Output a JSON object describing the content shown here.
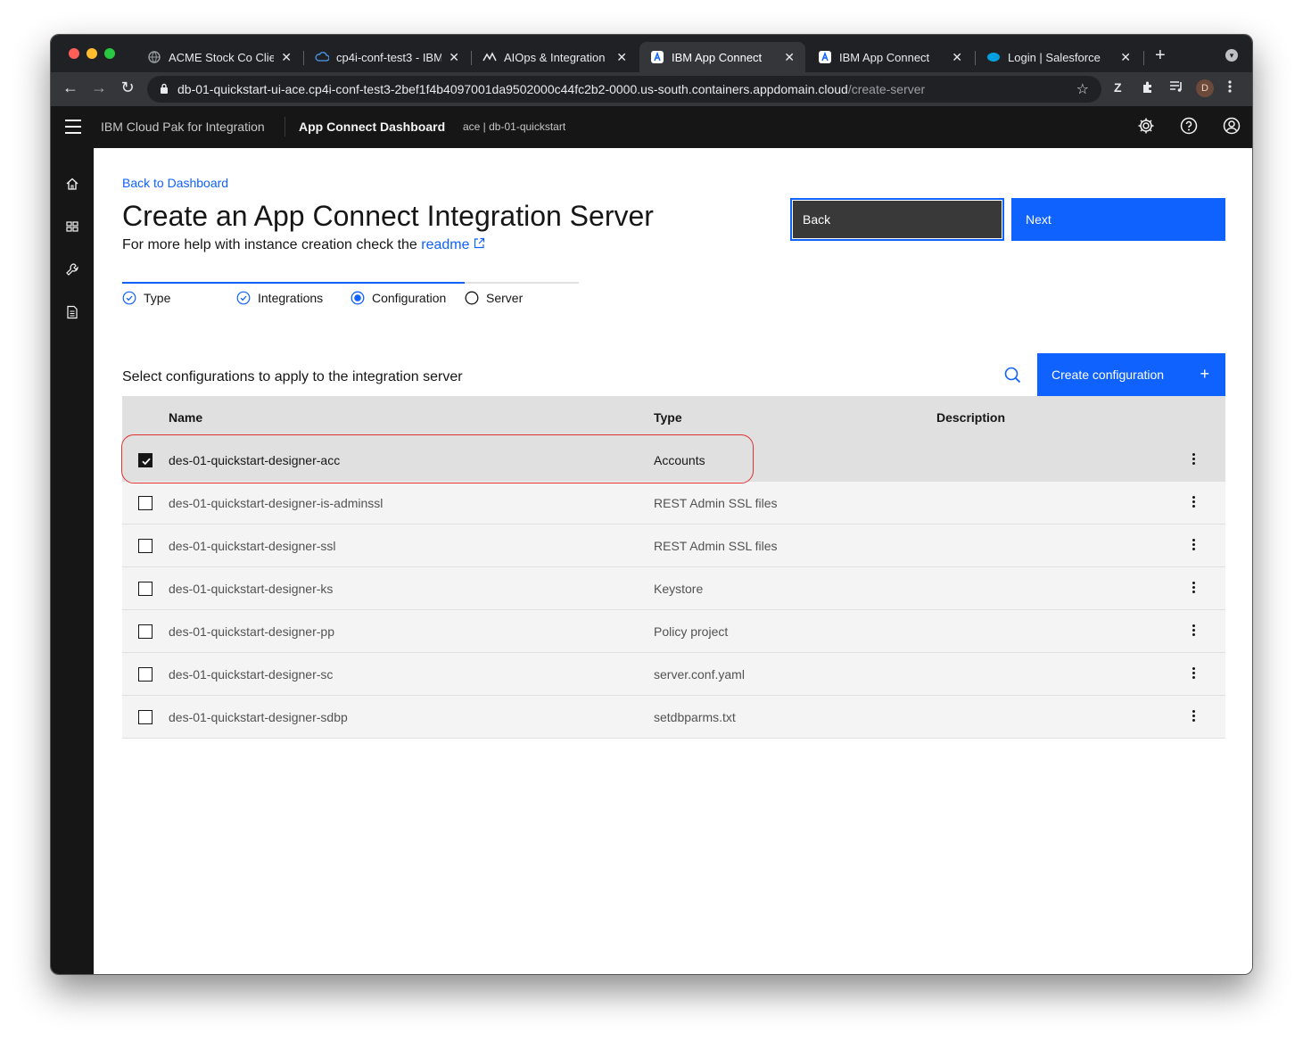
{
  "browser": {
    "tabs": [
      {
        "title": "ACME Stock Co Client",
        "icon": "globe-icon",
        "active": false
      },
      {
        "title": "cp4i-conf-test3 - IBM",
        "icon": "ibm-cloud-icon",
        "active": false
      },
      {
        "title": "AIOps & Integration Ex",
        "icon": "aiops-icon",
        "active": false
      },
      {
        "title": "IBM App Connect",
        "icon": "app-connect-icon",
        "active": true
      },
      {
        "title": "IBM App Connect",
        "icon": "app-connect-icon",
        "active": false
      },
      {
        "title": "Login | Salesforce",
        "icon": "salesforce-icon",
        "active": false
      }
    ],
    "url_host": "db-01-quickstart-ui-ace.cp4i-conf-test3-2bef1f4b4097001da9502000c44fc2b2-0000.us-south.containers.appdomain.cloud",
    "url_path": "/create-server",
    "profile_initial": "D",
    "extension_label": "Z"
  },
  "header": {
    "product": "IBM Cloud Pak for Integration",
    "app_name": "App Connect Dashboard",
    "instance": "ace | db-01-quickstart"
  },
  "page": {
    "back_link": "Back to Dashboard",
    "title": "Create an App Connect Integration Server",
    "help_prefix": "For more help with instance creation check the ",
    "help_link": "readme",
    "back_button": "Back",
    "next_button": "Next"
  },
  "progress": {
    "steps": [
      {
        "label": "Type",
        "state": "complete"
      },
      {
        "label": "Integrations",
        "state": "complete"
      },
      {
        "label": "Configuration",
        "state": "current"
      },
      {
        "label": "Server",
        "state": "incomplete"
      }
    ],
    "completed_fraction": 0.75
  },
  "table": {
    "title": "Select configurations to apply to the integration server",
    "create_button": "Create configuration",
    "headers": {
      "name": "Name",
      "type": "Type",
      "description": "Description"
    },
    "rows": [
      {
        "name": "des-01-quickstart-designer-acc",
        "type": "Accounts",
        "description": "",
        "checked": true
      },
      {
        "name": "des-01-quickstart-designer-is-adminssl",
        "type": "REST Admin SSL files",
        "description": "",
        "checked": false
      },
      {
        "name": "des-01-quickstart-designer-ssl",
        "type": "REST Admin SSL files",
        "description": "",
        "checked": false
      },
      {
        "name": "des-01-quickstart-designer-ks",
        "type": "Keystore",
        "description": "",
        "checked": false
      },
      {
        "name": "des-01-quickstart-designer-pp",
        "type": "Policy project",
        "description": "",
        "checked": false
      },
      {
        "name": "des-01-quickstart-designer-sc",
        "type": "server.conf.yaml",
        "description": "",
        "checked": false
      },
      {
        "name": "des-01-quickstart-designer-sdbp",
        "type": "setdbparms.txt",
        "description": "",
        "checked": false
      }
    ]
  },
  "colors": {
    "primary": "#0f62fe",
    "header_bg": "#161616",
    "highlight": "#e03131"
  }
}
